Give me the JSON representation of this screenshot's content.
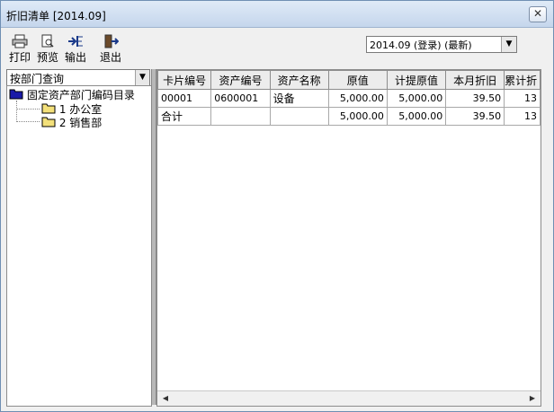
{
  "window": {
    "title": "折旧清单 [2014.09]",
    "close_label": "✕"
  },
  "toolbar": {
    "print": "打印",
    "preview": "预览",
    "export": "输出",
    "exit": "退出"
  },
  "period": {
    "selected": "2014.09 (登录) (最新)"
  },
  "query_mode": {
    "selected": "按部门查询"
  },
  "tree": {
    "root": "固定资产部门编码目录",
    "items": [
      {
        "code": "1",
        "name": "办公室"
      },
      {
        "code": "2",
        "name": "销售部"
      }
    ]
  },
  "table": {
    "columns": [
      "卡片编号",
      "资产编号",
      "资产名称",
      "原值",
      "计提原值",
      "本月折旧",
      "累计折"
    ],
    "rows": [
      [
        "00001",
        "0600001",
        "设备",
        "5,000.00",
        "5,000.00",
        "39.50",
        "13"
      ],
      [
        "合计",
        "",
        "",
        "5,000.00",
        "5,000.00",
        "39.50",
        "13"
      ]
    ]
  }
}
